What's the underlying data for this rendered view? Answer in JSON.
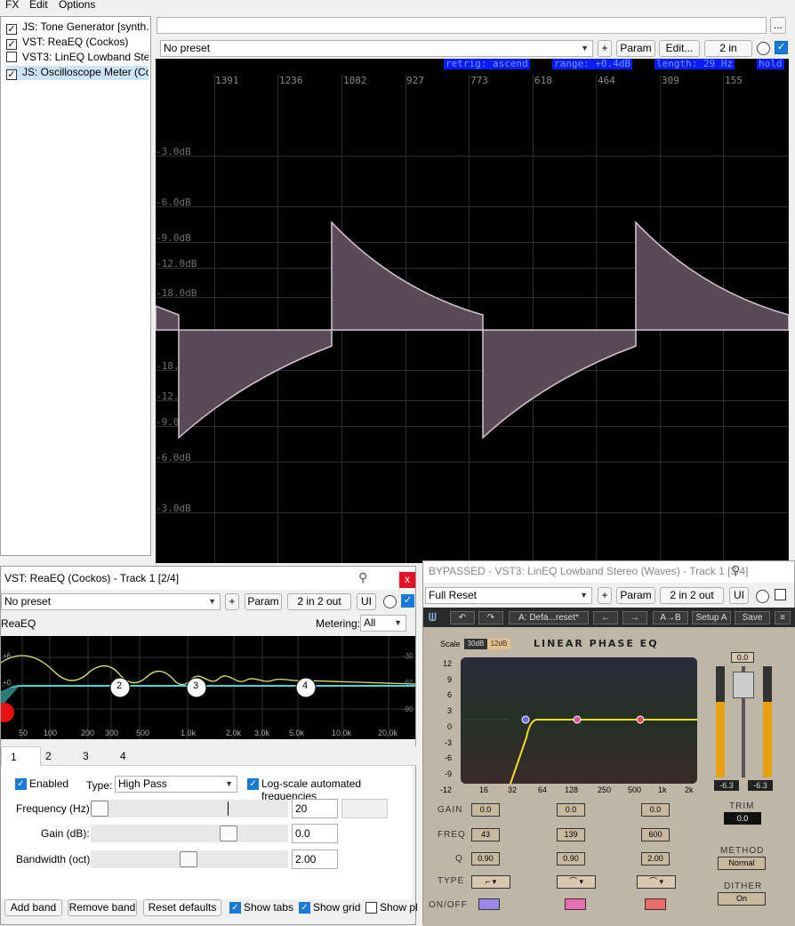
{
  "menu": {
    "items": [
      "FX",
      "Edit",
      "Options"
    ]
  },
  "fx_chain": {
    "items": [
      {
        "label": "JS: Tone Generator [synth...",
        "checked": true
      },
      {
        "label": "VST: ReaEQ (Cockos)",
        "checked": true
      },
      {
        "label": "VST3: LinEQ Lowband Ste...",
        "checked": false
      },
      {
        "label": "JS: Oscilloscope Meter (Co...",
        "checked": true
      }
    ]
  },
  "top_plugin": {
    "more_button": "...",
    "preset": "No preset",
    "add_button": "+",
    "param_button": "Param",
    "edit_button": "Edit...",
    "io_button": "2 in"
  },
  "oscilloscope": {
    "status": [
      "retrig: ascend",
      "range: +0.4dB",
      "length: 29 Hz",
      "hold"
    ],
    "freq_labels": [
      "1391",
      "1236",
      "1082",
      "927",
      "773",
      "618",
      "464",
      "309",
      "155"
    ],
    "db_labels_top": [
      "-3.0dB",
      "-6.0dB",
      "-9.0dB",
      "-12.0dB",
      "-18.0dB"
    ],
    "db_labels_bottom": [
      "-18.0dB",
      "-12.0dB",
      "-9.0dB",
      "-6.0dB",
      "-3.0dB"
    ]
  },
  "reaeq_window": {
    "title": "VST: ReaEQ (Cockos) - Track 1 [2/4]",
    "close": "x",
    "preset": "No preset",
    "add_button": "+",
    "param_button": "Param",
    "io_button": "2 in 2 out",
    "ui_button": "UI",
    "plugin_name": "ReaEQ",
    "metering_label": "Metering:",
    "metering_value": "All",
    "graph_db_left": [
      "+6",
      "+0"
    ],
    "graph_db_right": [
      "-30",
      "-60",
      "-90"
    ],
    "graph_freq": [
      "50",
      "100",
      "200",
      "300",
      "500",
      "1.0k",
      "2.0k",
      "3.0k",
      "5.0k",
      "10.0k",
      "20.0k"
    ],
    "band_nodes": [
      "2",
      "3",
      "4"
    ],
    "tabs": [
      "1",
      "2",
      "3",
      "4"
    ],
    "enabled_label": "Enabled",
    "type_label": "Type:",
    "type_value": "High Pass",
    "logscale_label": "Log-scale automated frequencies",
    "freq_label": "Frequency (Hz):",
    "freq_value": "20",
    "gain_label": "Gain (dB):",
    "gain_value": "0.0",
    "bw_label": "Bandwidth (oct):",
    "bw_value": "2.00",
    "add_band": "Add band",
    "remove_band": "Remove band",
    "reset_defaults": "Reset defaults",
    "show_tabs": "Show tabs",
    "show_grid": "Show grid",
    "show_phase": "Show pha"
  },
  "lineq_window": {
    "title": "BYPASSED - VST3: LinEQ Lowband Stereo (Waves) - Track 1 [3/4]",
    "preset": "Full Reset",
    "add_button": "+",
    "param_button": "Param",
    "io_button": "2 in 2 out",
    "ui_button": "UI",
    "preset_name": "A: Defa...reset*",
    "ab_button": "A→B",
    "setup_button": "Setup A",
    "save_button": "Save",
    "scale_label": "Scale",
    "scale_30": "30dB",
    "scale_12": "12dB",
    "logo": "LINEAR PHASE EQ",
    "y_axis": [
      "12",
      "9",
      "6",
      "3",
      "0",
      "-3",
      "-6",
      "-9",
      "-12"
    ],
    "x_axis": [
      "16",
      "32",
      "64",
      "128",
      "250",
      "500",
      "1k",
      "2k"
    ],
    "gain_label": "GAIN",
    "freq_label": "FREQ",
    "q_label": "Q",
    "type_label": "TYPE",
    "onoff_label": "ON/OFF",
    "bands": [
      {
        "gain": "0.0",
        "freq": "43",
        "q": "0.90"
      },
      {
        "gain": "0.0",
        "freq": "139",
        "q": "0.90"
      },
      {
        "gain": "0.0",
        "freq": "600",
        "q": "2.00"
      }
    ],
    "trim_label": "TRIM",
    "trim_value": "0.0",
    "meter_value": "0.0",
    "meter_left": "-6.3",
    "meter_right": "-6.3",
    "method_label": "METHOD",
    "method_value": "Normal",
    "dither_label": "DITHER",
    "dither_value": "On"
  }
}
